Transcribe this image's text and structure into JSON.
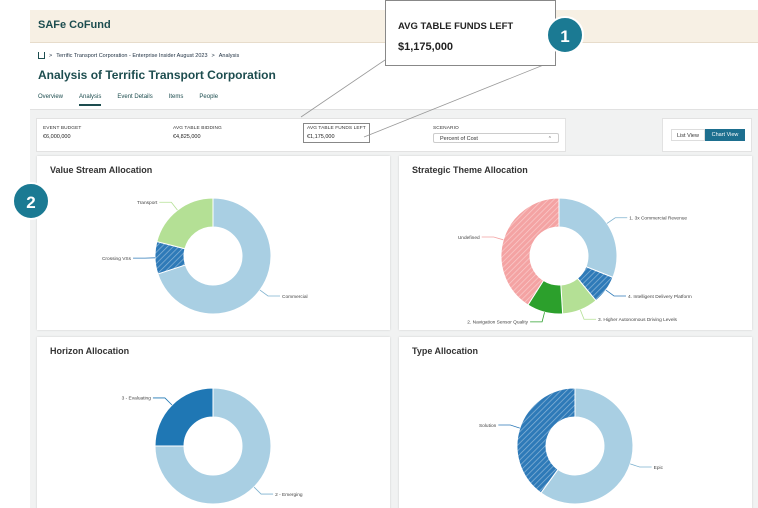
{
  "app": {
    "brand": "SAFe CoFund"
  },
  "breadcrumb": {
    "items": [
      "Terrific Transport Corporation - Enterprise Insider August 2023",
      "Analysis"
    ],
    "separator": ">"
  },
  "page": {
    "title": "Analysis of Terrific Transport Corporation"
  },
  "tabs": [
    {
      "label": "Overview",
      "active": false
    },
    {
      "label": "Analysis",
      "active": true
    },
    {
      "label": "Event Details",
      "active": false
    },
    {
      "label": "Items",
      "active": false
    },
    {
      "label": "People",
      "active": false
    }
  ],
  "stats": {
    "event_budget": {
      "label": "EVENT BUDGET",
      "value": "€6,000,000"
    },
    "avg_table_bidding": {
      "label": "AVG TABLE BIDDING",
      "value": "€4,825,000"
    },
    "avg_table_funds_left": {
      "label": "AVG TABLE FUNDS LEFT",
      "value": "€1,175,000"
    },
    "scenario": {
      "label": "SCENARIO",
      "value": "Percent of Cost"
    }
  },
  "view_toggle": {
    "list_label": "List View",
    "chart_label": "Chart View",
    "active": "Chart View"
  },
  "callout": {
    "label": "AVG TABLE FUNDS LEFT",
    "value": "$1,175,000"
  },
  "badges": {
    "one": "1",
    "two": "2"
  },
  "colors": {
    "brand": "#1d4d4f",
    "accent": "#1d6f8f",
    "badge": "#1b7a93",
    "light_blue": "#a9cfe3",
    "mid_blue": "#2e7ab8",
    "dark_blue": "#1f77b4",
    "light_green": "#b4e095",
    "green": "#2ca02c",
    "pink": "#f4a3a3"
  },
  "chart_data": [
    {
      "type": "pie",
      "title": "Value Stream Allocation",
      "donut": true,
      "slices": [
        {
          "label": "Commercial",
          "value": 70,
          "color": "#a9cfe3",
          "hatched": false
        },
        {
          "label": "Crossing VSs",
          "value": 9,
          "color": "#2e7ab8",
          "hatched": true
        },
        {
          "label": "Transport",
          "value": 21,
          "color": "#b4e095",
          "hatched": false
        }
      ]
    },
    {
      "type": "pie",
      "title": "Strategic Theme Allocation",
      "donut": true,
      "slices": [
        {
          "label": "1. 3x Commercial Revenue",
          "value": 31,
          "color": "#a9cfe3",
          "hatched": false
        },
        {
          "label": "4. Intelligent Delivery Platform",
          "value": 8,
          "color": "#2e7ab8",
          "hatched": true
        },
        {
          "label": "3. Higher Autonomous Driving Levels",
          "value": 10,
          "color": "#b4e095",
          "hatched": false
        },
        {
          "label": "2. Navigation Sensor Quality",
          "value": 10,
          "color": "#2ca02c",
          "hatched": false
        },
        {
          "label": "Undefined",
          "value": 41,
          "color": "#f4a3a3",
          "hatched": true
        }
      ]
    },
    {
      "type": "pie",
      "title": "Horizon Allocation",
      "donut": true,
      "slices": [
        {
          "label": "2 - Emerging",
          "value": 75,
          "color": "#a9cfe3",
          "hatched": false
        },
        {
          "label": "3 - Evaluating",
          "value": 25,
          "color": "#1f77b4",
          "hatched": false
        }
      ]
    },
    {
      "type": "pie",
      "title": "Type Allocation",
      "donut": true,
      "slices": [
        {
          "label": "Epic",
          "value": 60,
          "color": "#a9cfe3",
          "hatched": false
        },
        {
          "label": "Solution",
          "value": 40,
          "color": "#2e7ab8",
          "hatched": true
        }
      ]
    }
  ]
}
